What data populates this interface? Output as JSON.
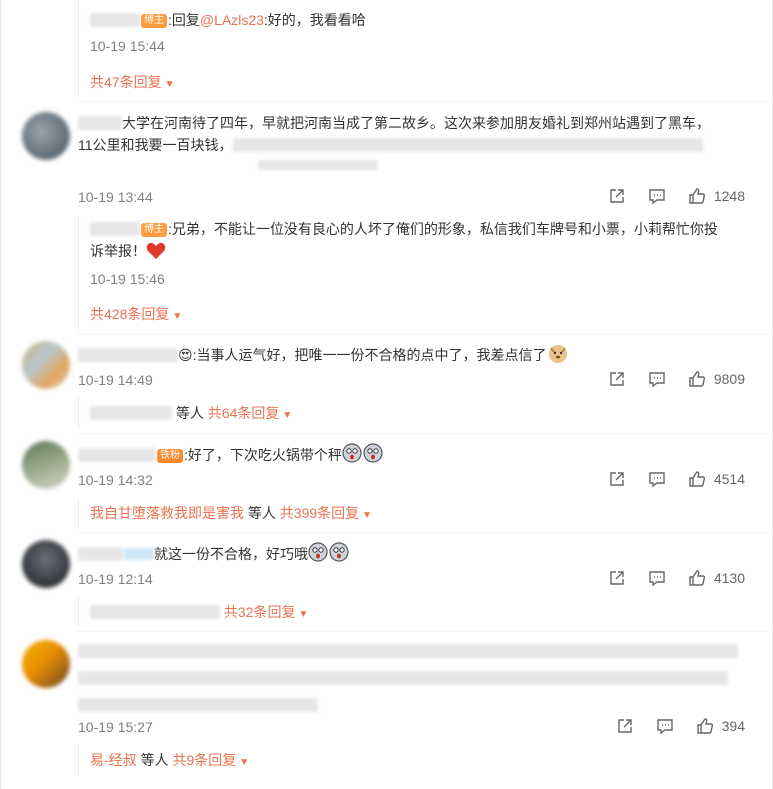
{
  "colors": {
    "accent": "#eb7350",
    "time": "#808080",
    "text": "#333333",
    "heart": "#e0392b"
  },
  "icons": {
    "share": "share-icon",
    "comment": "comment-icon",
    "like": "thumbs-up-icon",
    "more": "chevron-down-icon"
  },
  "top_reply": {
    "text": ":回复",
    "mention": "@LAzls23",
    "text2": ":好的，我看看哈",
    "badge": "博主",
    "time": "10-19 15:44",
    "more": "共47条回复"
  },
  "comments": [
    {
      "line1": "大学在河南待了四年，早就把河南当成了第二故乡。这次来参加朋友婚礼到郑州站遇到了黑车，",
      "line2": "11公里和我要一百块钱，",
      "time": "10-19 13:44",
      "likes": "1248",
      "reply": {
        "badge": "博主",
        "line1": ":兄弟，不能让一位没有良心的人坏了俺们的形象，私信我们车牌号和小票，小莉帮忙你投",
        "line2": "诉举报！",
        "time": "10-19 15:46",
        "more": "共428条回复"
      }
    },
    {
      "line1": ":当事人运气好，把唯一一份不合格的点中了，我差点信了",
      "time": "10-19 14:49",
      "likes": "9809",
      "more_prefix": "等人",
      "more": "共64条回复"
    },
    {
      "badge": "铁粉",
      "line1": ":好了，下次吃火锅带个秤",
      "time": "10-19 14:32",
      "likes": "4514",
      "replier": "我自甘堕落救我即是害我",
      "more_prefix": "等人",
      "more": "共399条回复"
    },
    {
      "line1": "就这一份不合格，好巧哦",
      "time": "10-19 12:14",
      "likes": "4130",
      "more": "共32条回复"
    },
    {
      "time": "10-19 15:27",
      "likes": "394",
      "replier": "易-经叔",
      "more_prefix": "等人",
      "more": "共9条回复"
    }
  ]
}
